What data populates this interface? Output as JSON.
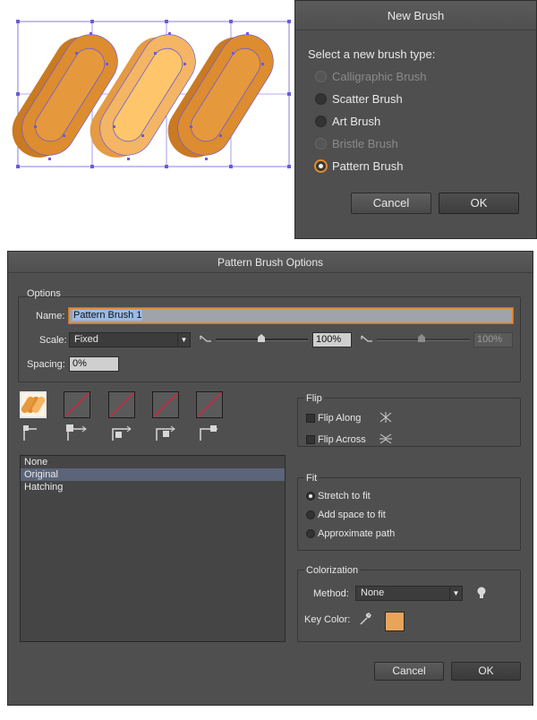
{
  "artwork": {
    "colors": {
      "outer": "#dd8c2f",
      "outer_dark": "#c97a22",
      "inner": "#f0ac5a",
      "center": "#ffc56b",
      "path": "#6a5dd8"
    }
  },
  "new_brush": {
    "title": "New Brush",
    "prompt": "Select a new brush type:",
    "options": [
      {
        "label": "Calligraphic Brush",
        "state": "disabled"
      },
      {
        "label": "Scatter Brush",
        "state": "enabled"
      },
      {
        "label": "Art Brush",
        "state": "enabled"
      },
      {
        "label": "Bristle Brush",
        "state": "disabled"
      },
      {
        "label": "Pattern Brush",
        "state": "selected"
      }
    ],
    "cancel_label": "Cancel",
    "ok_label": "OK"
  },
  "pattern_options": {
    "title": "Pattern Brush Options",
    "options_group": {
      "title": "Options",
      "name_label": "Name:",
      "name_value": "Pattern Brush 1",
      "scale_label": "Scale:",
      "scale_mode": "Fixed",
      "scale_value": "100%",
      "scale_value_2": "100%",
      "spacing_label": "Spacing:",
      "spacing_value": "0%"
    },
    "tile_list": [
      "None",
      "Original",
      "Hatching"
    ],
    "tile_list_selected": "Original",
    "flip": {
      "title": "Flip",
      "along_label": "Flip Along",
      "across_label": "Flip Across"
    },
    "fit": {
      "title": "Fit",
      "options": [
        "Stretch to fit",
        "Add space to fit",
        "Approximate path"
      ],
      "selected": "Stretch to fit"
    },
    "colorization": {
      "title": "Colorization",
      "method_label": "Method:",
      "method_value": "None",
      "key_color_label": "Key Color:",
      "key_color": "#e8a55a"
    },
    "cancel_label": "Cancel",
    "ok_label": "OK"
  }
}
